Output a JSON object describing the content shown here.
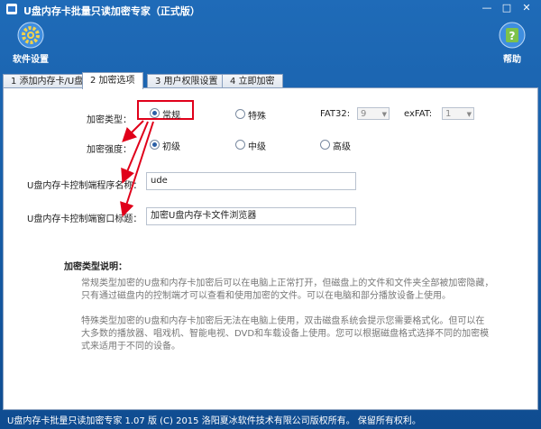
{
  "window": {
    "title": "U盘内存卡批量只读加密专家（正式版）",
    "min_glyph": "—",
    "max_glyph": "□",
    "close_glyph": "✕"
  },
  "toolbar": {
    "settings_label": "软件设置",
    "help_label": "帮助"
  },
  "tabs": [
    {
      "label": "1 添加内存卡/U盘"
    },
    {
      "label": "2 加密选项"
    },
    {
      "label": "3 用户权限设置"
    },
    {
      "label": "4 立即加密"
    }
  ],
  "form": {
    "encryption_type_label": "加密类型：",
    "type_options": [
      "常规",
      "特殊"
    ],
    "selected_type": "常规",
    "fat32_label": "FAT32:",
    "fat32_value": "9",
    "exfat_label": "exFAT:",
    "exfat_value": "1",
    "strength_label": "加密强度：",
    "strength_options": [
      "初级",
      "中级",
      "高级"
    ],
    "selected_strength": "初级",
    "program_name_label": "U盘内存卡控制端程序名称：",
    "program_name_value": "ude",
    "window_title_label": "U盘内存卡控制端窗口标题：",
    "window_title_value": "加密U盘内存卡文件浏览器"
  },
  "description": {
    "heading": "加密类型说明：",
    "para1_line1": "常规类型加密的U盘和内存卡加密后可以在电脑上正常打开，但磁盘上的文件和文件夹全部被加密隐藏，",
    "para1_line2": "只有通过磁盘内的控制端才可以查看和使用加密的文件。可以在电脑和部分播放设备上使用。",
    "para2_line1": "特殊类型加密的U盘和内存卡加密后无法在电脑上使用，双击磁盘系统会提示您需要格式化。但可以在",
    "para2_line2": "大多数的播放器、唱戏机、智能电视、DVD和车载设备上使用。您可以根据磁盘格式选择不同的加密模",
    "para2_line3": "式来适用于不同的设备。"
  },
  "status": {
    "copyright": "U盘内存卡批量只读加密专家 1.07 版  (C)  2015 洛阳夏冰软件技术有限公司版权所有。 保留所有权利。"
  },
  "colors": {
    "frame_blue": "#1f6bb8",
    "highlight_red": "#e0001a"
  }
}
